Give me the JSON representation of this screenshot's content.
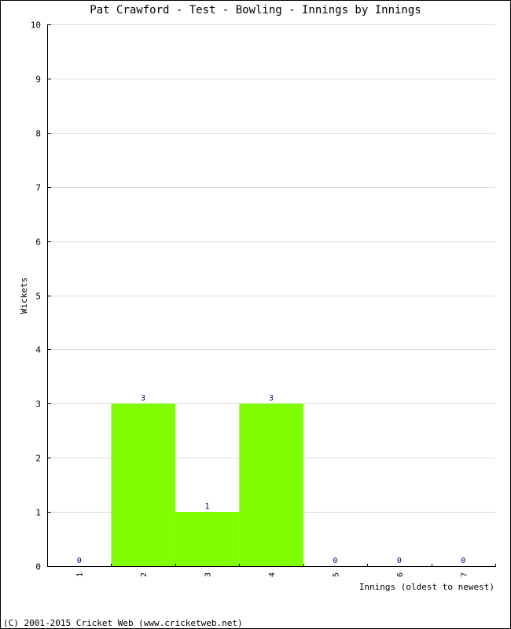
{
  "chart_data": {
    "type": "bar",
    "title": "Pat Crawford - Test - Bowling - Innings by Innings",
    "xlabel": "Innings (oldest to newest)",
    "ylabel": "Wickets",
    "categories": [
      "1",
      "2",
      "3",
      "4",
      "5",
      "6",
      "7"
    ],
    "values": [
      0,
      3,
      1,
      3,
      0,
      0,
      0
    ],
    "ylim": [
      0,
      10
    ],
    "yticks": [
      0,
      1,
      2,
      3,
      4,
      5,
      6,
      7,
      8,
      9,
      10
    ],
    "grid": true,
    "bar_color": "#80ff00",
    "label_color": "#000080",
    "grid_color": "#dddddd"
  },
  "footer": "(C) 2001-2015 Cricket Web (www.cricketweb.net)"
}
